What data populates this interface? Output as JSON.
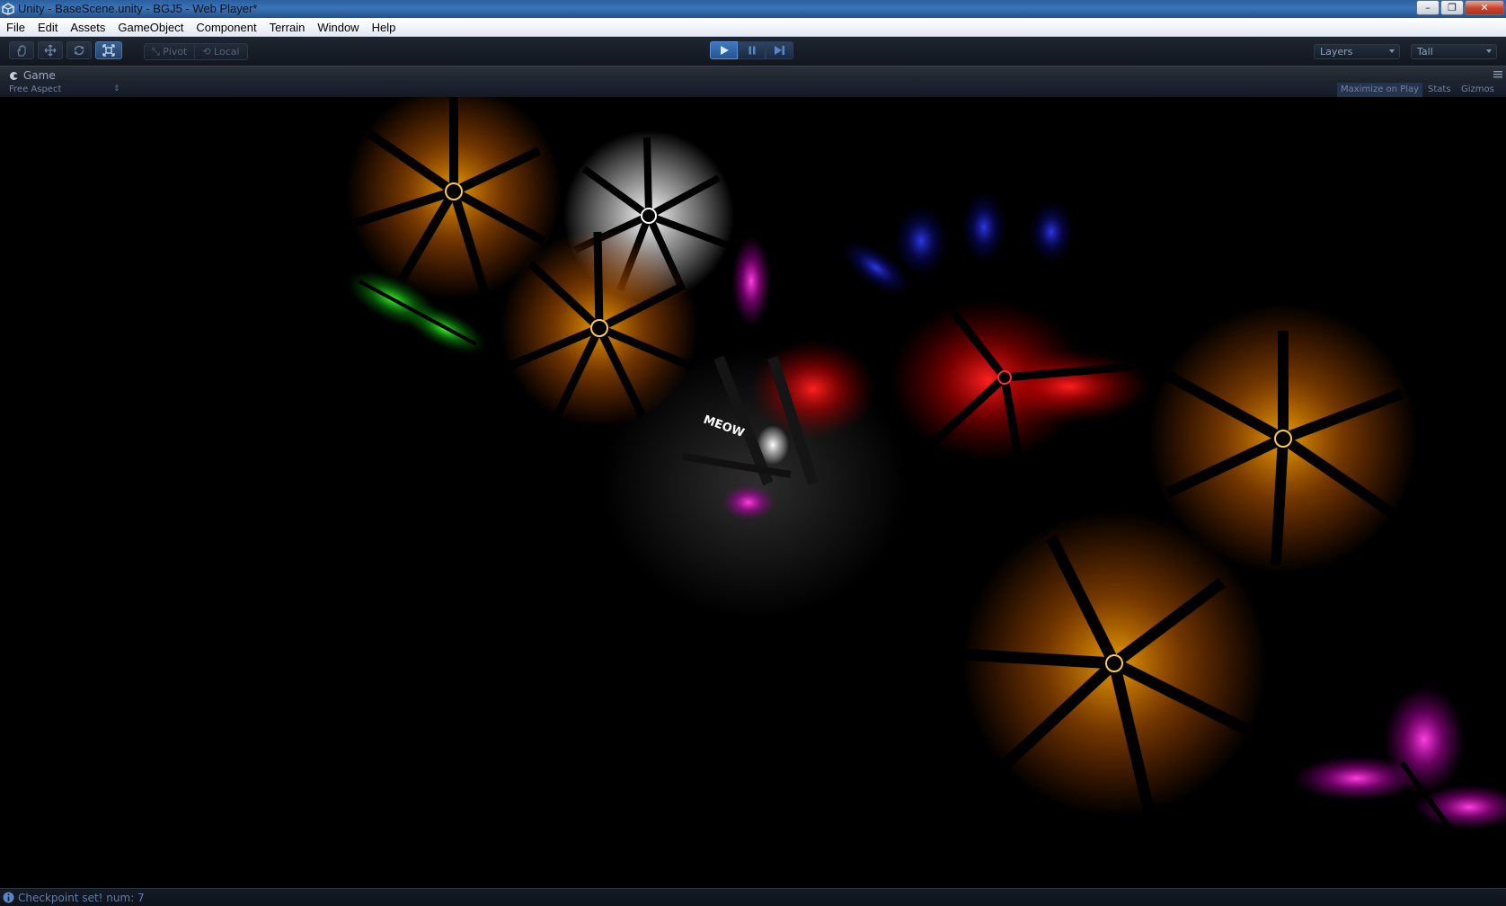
{
  "window": {
    "title": "Unity - BaseScene.unity - BGJ5 - Web Player*",
    "buttons": {
      "minimize": "–",
      "maximize": "❐",
      "close": "✕"
    }
  },
  "menu": [
    "File",
    "Edit",
    "Assets",
    "GameObject",
    "Component",
    "Terrain",
    "Window",
    "Help"
  ],
  "toolbar": {
    "tools": [
      "hand-tool",
      "move-tool",
      "rotate-tool",
      "scale-tool"
    ],
    "active_tool": "scale-tool",
    "pivot_label": "Pivot",
    "local_label": "Local",
    "play_active": true,
    "layers_label": "Layers",
    "layout_label": "Tall"
  },
  "game_panel": {
    "tab_label": "Game",
    "aspect_label": "Free Aspect",
    "maximize_on_play": "Maximize on Play",
    "stats": "Stats",
    "gizmos": "Gizmos",
    "scene_text": "MEOW"
  },
  "status": {
    "message": "Checkpoint set! num: 7"
  },
  "colors": {
    "orange_light": "#ffb300",
    "white_light": "#ffffff",
    "red_light": "#ff1a1a",
    "magenta_light": "#ff2bd9",
    "green_light": "#35ff2a",
    "blue_light": "#2a2aff"
  }
}
